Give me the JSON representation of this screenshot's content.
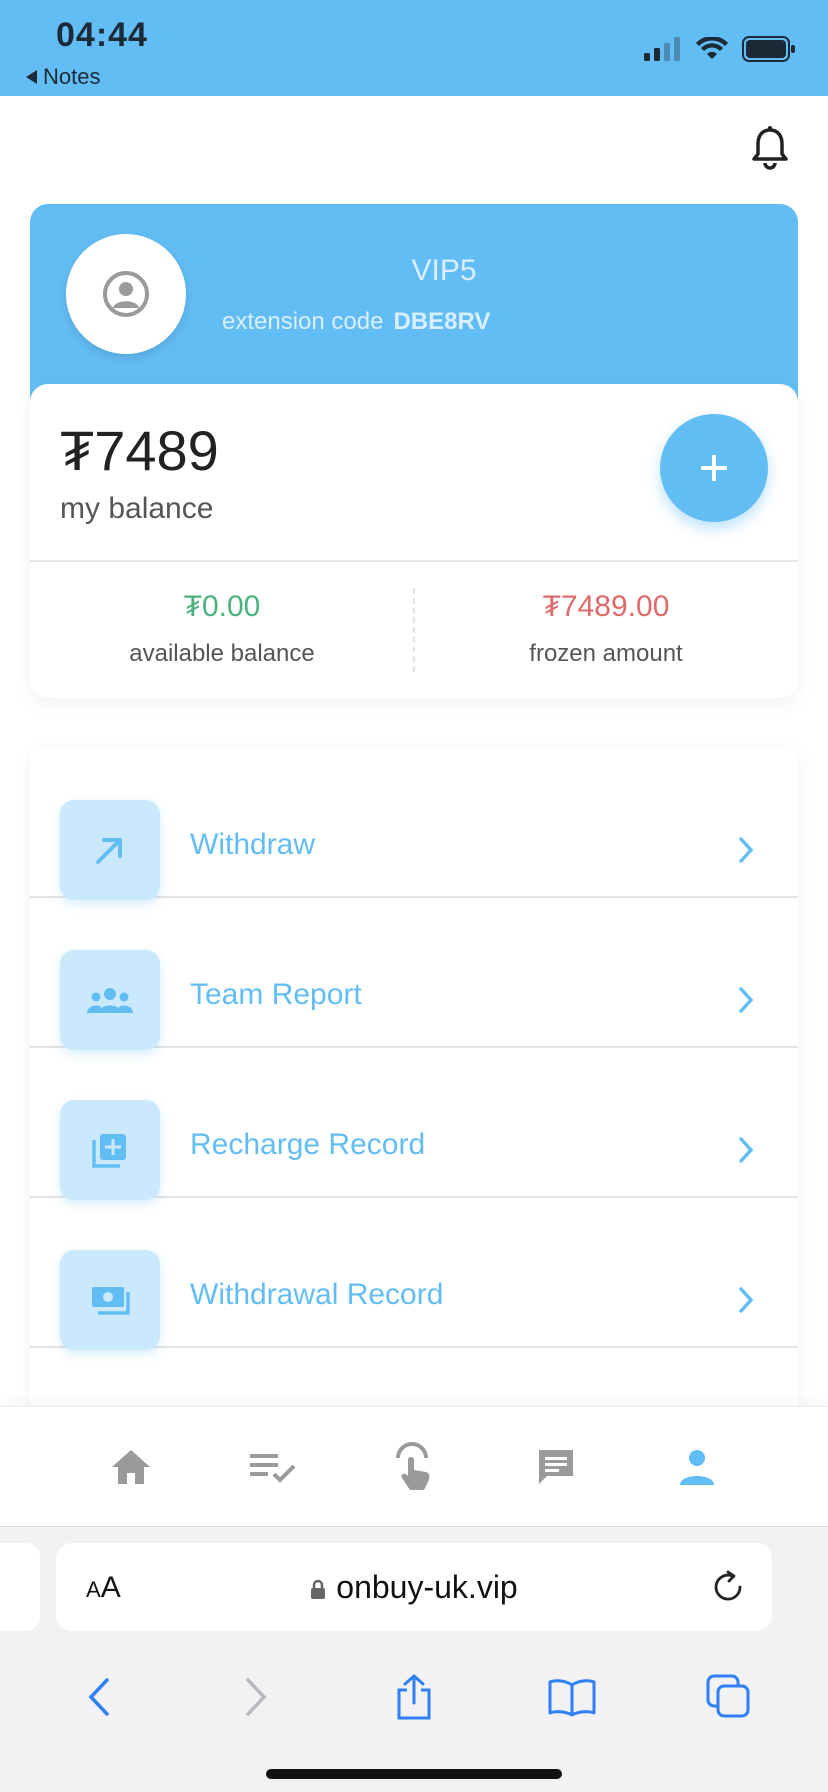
{
  "status_bar": {
    "time": "04:44",
    "back_label": "Notes",
    "icons": [
      "signal-icon",
      "wifi-icon",
      "battery-icon"
    ]
  },
  "header": {
    "icons": [
      "bell-icon"
    ]
  },
  "profile": {
    "vip_level": "VIP5",
    "extension_label": "extension code",
    "extension_code": "DBE8RV"
  },
  "balance": {
    "amount": "₮7489",
    "label": "my balance",
    "available_value": "₮0.00",
    "available_label": "available balance",
    "frozen_value": "₮7489.00",
    "frozen_label": "frozen amount"
  },
  "menu": {
    "items": [
      {
        "label": "Withdraw",
        "icon": "withdraw-arrow-icon"
      },
      {
        "label": "Team Report",
        "icon": "team-icon"
      },
      {
        "label": "Recharge Record",
        "icon": "add-box-icon"
      },
      {
        "label": "Withdrawal Record",
        "icon": "cash-icon"
      }
    ]
  },
  "tabbar": {
    "items": [
      "home-icon",
      "task-list-icon",
      "tap-icon",
      "message-icon",
      "profile-icon"
    ],
    "active_index": 4
  },
  "browser": {
    "aa_label_big": "A",
    "aa_label_small": "A",
    "url": "onbuy-uk.vip"
  },
  "colors": {
    "accent": "#63bdf5",
    "available": "#4cb27c",
    "frozen": "#e06a6a"
  }
}
